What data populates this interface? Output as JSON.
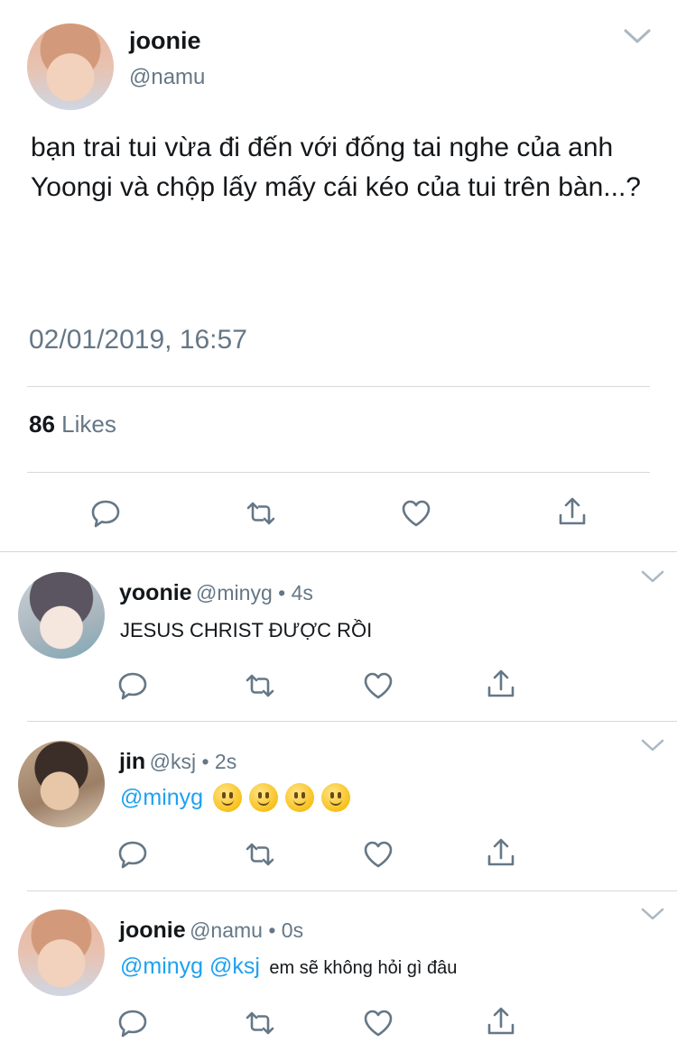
{
  "main_tweet": {
    "name": "joonie",
    "handle": "@namu",
    "text": "bạn trai tui vừa đi đến với đống tai nghe của anh Yoongi và chộp lấy mấy cái kéo của tui trên bàn...?",
    "timestamp": "02/01/2019, 16:57",
    "likes_count": "86",
    "likes_label": "Likes"
  },
  "replies": [
    {
      "name": "yoonie",
      "meta": "@minyg • 4s",
      "text": "JESUS CHRIST ĐƯỢC RỒI"
    },
    {
      "name": "jin",
      "meta": "@ksj • 2s",
      "mention": "@minyg",
      "emoji_count": 4
    },
    {
      "name": "joonie",
      "meta": "@namu • 0s",
      "mentions": "@minyg @ksj",
      "text": "em sẽ không hỏi gì đâu"
    }
  ],
  "icons": [
    "reply-icon",
    "retweet-icon",
    "like-icon",
    "share-icon",
    "chevron-down-icon"
  ],
  "colors": {
    "mention": "#1da1f2",
    "secondary_text": "#657786",
    "divider": "#d6d9dc"
  }
}
